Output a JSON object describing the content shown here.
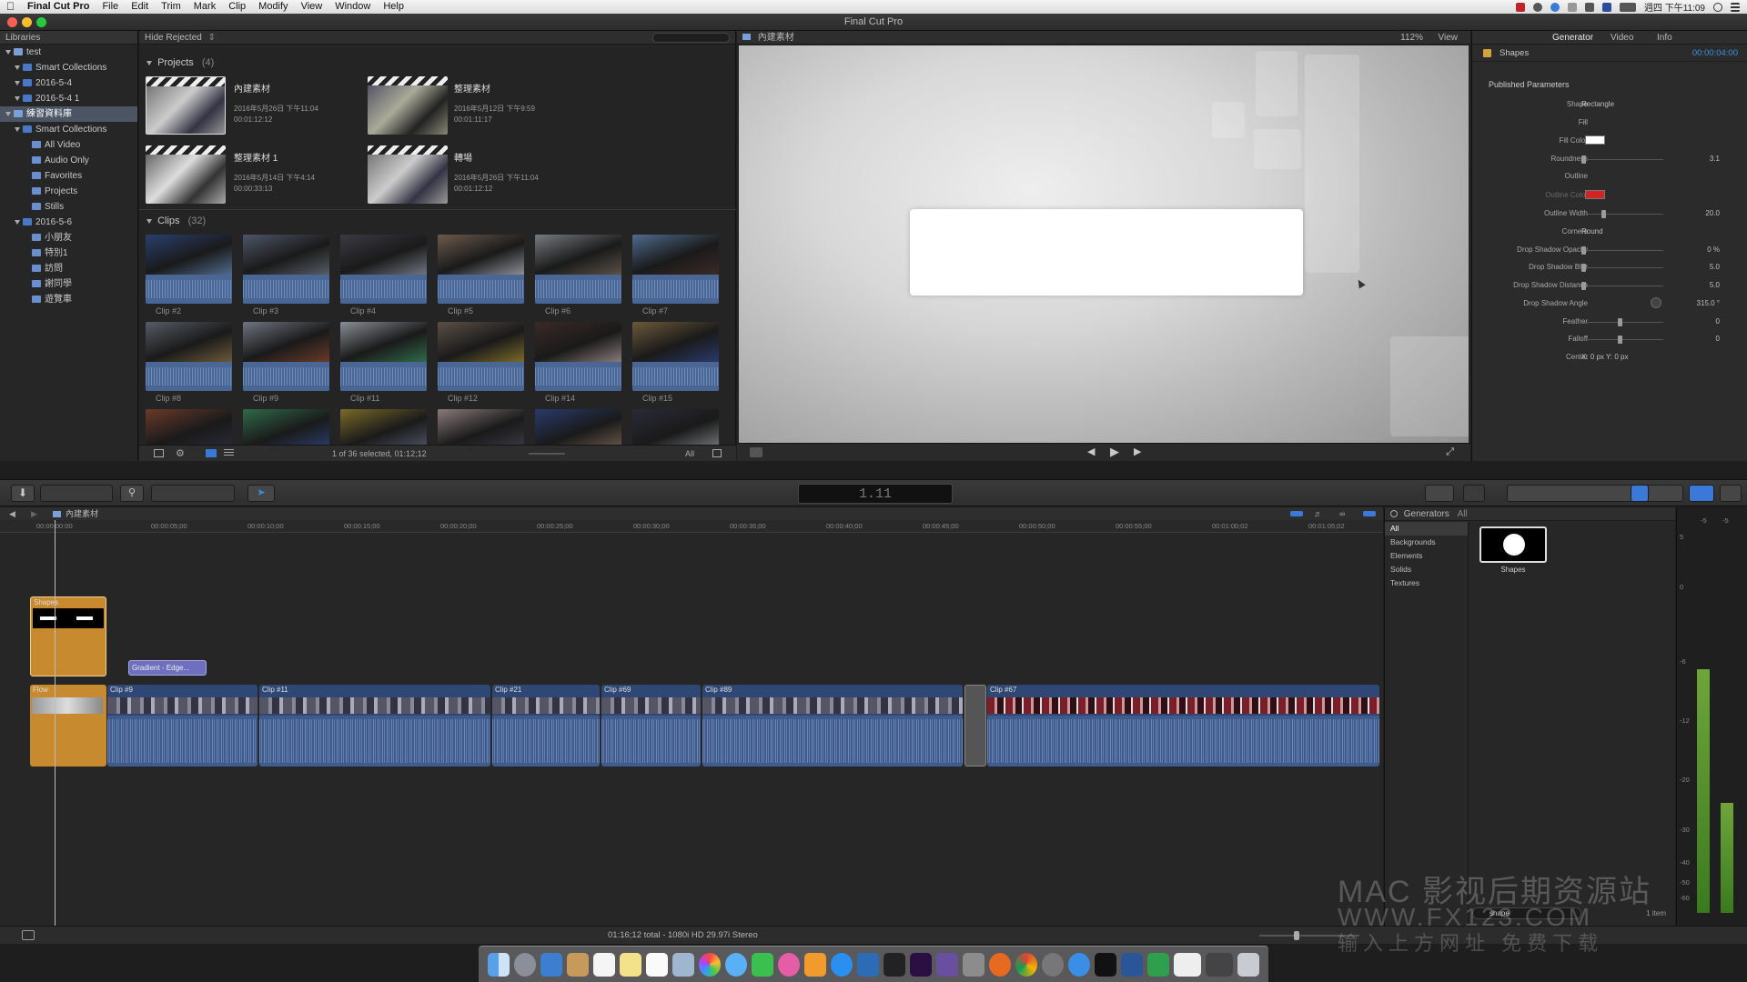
{
  "menubar": {
    "app": "Final Cut Pro",
    "items": [
      "File",
      "Edit",
      "Trim",
      "Mark",
      "Clip",
      "Modify",
      "View",
      "Window",
      "Help"
    ],
    "clock": "週四 下午11:09"
  },
  "window": {
    "title": "Final Cut Pro"
  },
  "libraries": {
    "header": "Libraries",
    "rows": [
      {
        "label": "test",
        "level": 0
      },
      {
        "label": "Smart Collections",
        "level": 1
      },
      {
        "label": "2016-5-4",
        "level": 1
      },
      {
        "label": "2016-5-4 1",
        "level": 1
      },
      {
        "label": "練習資料庫",
        "level": 0
      },
      {
        "label": "Smart Collections",
        "level": 1
      },
      {
        "label": "All Video",
        "level": 2
      },
      {
        "label": "Audio Only",
        "level": 2
      },
      {
        "label": "Favorites",
        "level": 2
      },
      {
        "label": "Projects",
        "level": 2
      },
      {
        "label": "Stills",
        "level": 2
      },
      {
        "label": "2016-5-6",
        "level": 1
      },
      {
        "label": "小朋友",
        "level": 2
      },
      {
        "label": "特別1",
        "level": 2
      },
      {
        "label": "訪問",
        "level": 2
      },
      {
        "label": "謝同學",
        "level": 2
      },
      {
        "label": "遊覽車",
        "level": 2
      }
    ]
  },
  "browser": {
    "filter": "Hide Rejected",
    "projects_label": "Projects",
    "projects_count": "(4)",
    "clips_label": "Clips",
    "clips_count": "(32)",
    "projects": [
      {
        "title": "內建素材",
        "date": "2016年5月26日 下午11:04",
        "dur": "00:01:12:12"
      },
      {
        "title": "整理素材",
        "date": "2016年5月12日 下午9:59",
        "dur": "00:01:11:17"
      },
      {
        "title": "整理素材 1",
        "date": "2016年5月14日 下午4:14",
        "dur": "00:00:33:13"
      },
      {
        "title": "轉場",
        "date": "2016年5月26日 下午11:04",
        "dur": "00:01:12:12"
      }
    ],
    "clips": [
      "Clip #2",
      "Clip #3",
      "Clip #4",
      "Clip #5",
      "Clip #6",
      "Clip #7",
      "Clip #8",
      "Clip #9",
      "Clip #11",
      "Clip #12",
      "Clip #14",
      "Clip #15"
    ],
    "status": "1 of 36 selected, 01:12;12",
    "all": "All"
  },
  "viewer": {
    "title": "內建素材",
    "zoom": "112%",
    "view": "View"
  },
  "inspector": {
    "tabs": [
      "Generator",
      "Video",
      "Info"
    ],
    "item": "Shapes",
    "tc": "00:00:04:00",
    "section": "Published Parameters",
    "params": [
      {
        "label": "Shape",
        "value": "Rectangle"
      },
      {
        "label": "Fill",
        "value": "✓"
      },
      {
        "label": "Fill Color",
        "value": ""
      },
      {
        "label": "Roundness",
        "value": "3.1"
      },
      {
        "label": "Outline",
        "value": ""
      },
      {
        "label": "Outline Color",
        "value": ""
      },
      {
        "label": "Outline Width",
        "value": "20.0"
      },
      {
        "label": "Corners",
        "value": "Round"
      },
      {
        "label": "Drop Shadow Opacity",
        "value": "0 %"
      },
      {
        "label": "Drop Shadow Blur",
        "value": "5.0"
      },
      {
        "label": "Drop Shadow Distance",
        "value": "5.0"
      },
      {
        "label": "Drop Shadow Angle",
        "value": "315.0 °"
      },
      {
        "label": "Feather",
        "value": "0"
      },
      {
        "label": "Falloff",
        "value": "0"
      },
      {
        "label": "Center",
        "value": "X:  0 px   Y:  0 px"
      }
    ]
  },
  "toolbar": {
    "timecode": "1.11"
  },
  "timeline": {
    "project": "內建素材",
    "ruler": [
      "00:00:00:00",
      "00:00:05;00",
      "00:00:10;00",
      "00:00:15;00",
      "00:00:20;00",
      "00:00:25;00",
      "00:00:30;00",
      "00:00:35;00",
      "00:00:40;00",
      "00:00:45;00",
      "00:00:50;00",
      "00:00:55;00",
      "00:01:00;02",
      "00:01:05;02"
    ],
    "shapes_clip": "Shapes",
    "flow_clip": "Flow",
    "transition": "Gradient - Edge...",
    "clips": [
      "Clip #9",
      "Clip #11",
      "Clip #21",
      "Clip #69",
      "Clip #89",
      "Clip #67"
    ],
    "footer": "01:16;12 total - 1080i HD 29.97i Stereo"
  },
  "generators": {
    "header": "Generators",
    "all": "All",
    "categories": [
      "All",
      "Backgrounds",
      "Elements",
      "Solids",
      "Textures"
    ],
    "item": "Shapes",
    "search": "shape",
    "count": "1 item"
  },
  "meters": {
    "labels": [
      "-6",
      "-12",
      "-20",
      "-30",
      "-40",
      "-50",
      "-60",
      "0",
      "5",
      "-5"
    ]
  },
  "watermark": {
    "line1": "MAC 影视后期资源站",
    "line2": "WWW.FX123.COM",
    "line3": "输入上方网址 免费下载"
  },
  "colors": {
    "accent": "#3b79d9",
    "selection": "#4b5563",
    "connected_clip": "#c88a2f",
    "transition": "#6f6fbf",
    "fill_color": "#ffffff",
    "outline_color": "#d22424"
  }
}
